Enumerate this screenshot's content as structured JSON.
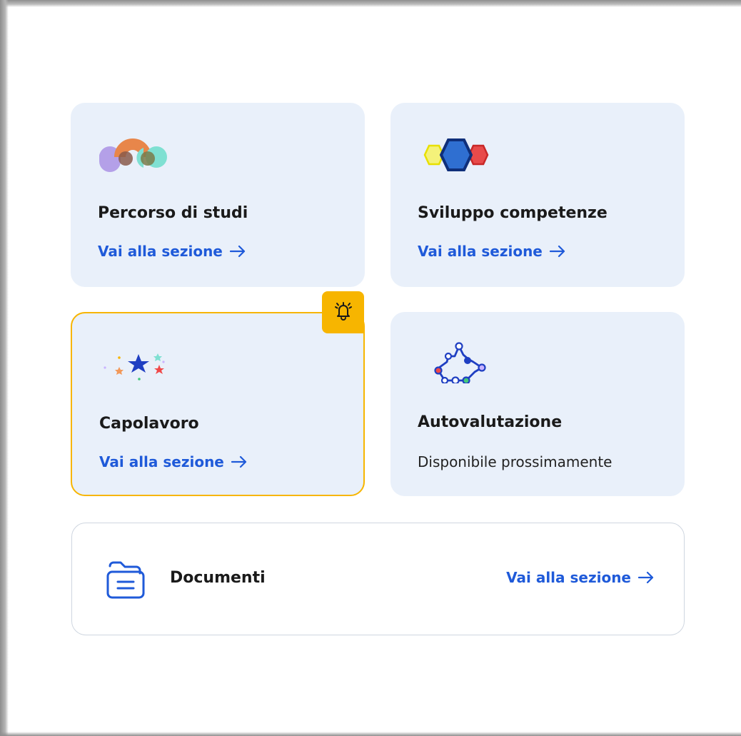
{
  "cards": [
    {
      "title": "Percorso di studi",
      "link_label": "Vai alla sezione",
      "icon": "overlapping-arcs-icon"
    },
    {
      "title": "Sviluppo competenze",
      "link_label": "Vai alla sezione",
      "icon": "hexagons-icon"
    },
    {
      "title": "Capolavoro",
      "link_label": "Vai alla sezione",
      "icon": "stars-icon",
      "notification": true,
      "notification_icon": "bell-icon"
    },
    {
      "title": "Autovalutazione",
      "subtitle": "Disponibile prossimamente",
      "icon": "network-nodes-icon"
    }
  ],
  "documents": {
    "title": "Documenti",
    "link_label": "Vai alla sezione",
    "icon": "folder-document-icon"
  },
  "colors": {
    "card_background": "#e9f0fa",
    "link": "#1f5ad9",
    "highlight_border": "#f7b500",
    "badge": "#f7b500",
    "title_text": "#1a1a1a"
  }
}
